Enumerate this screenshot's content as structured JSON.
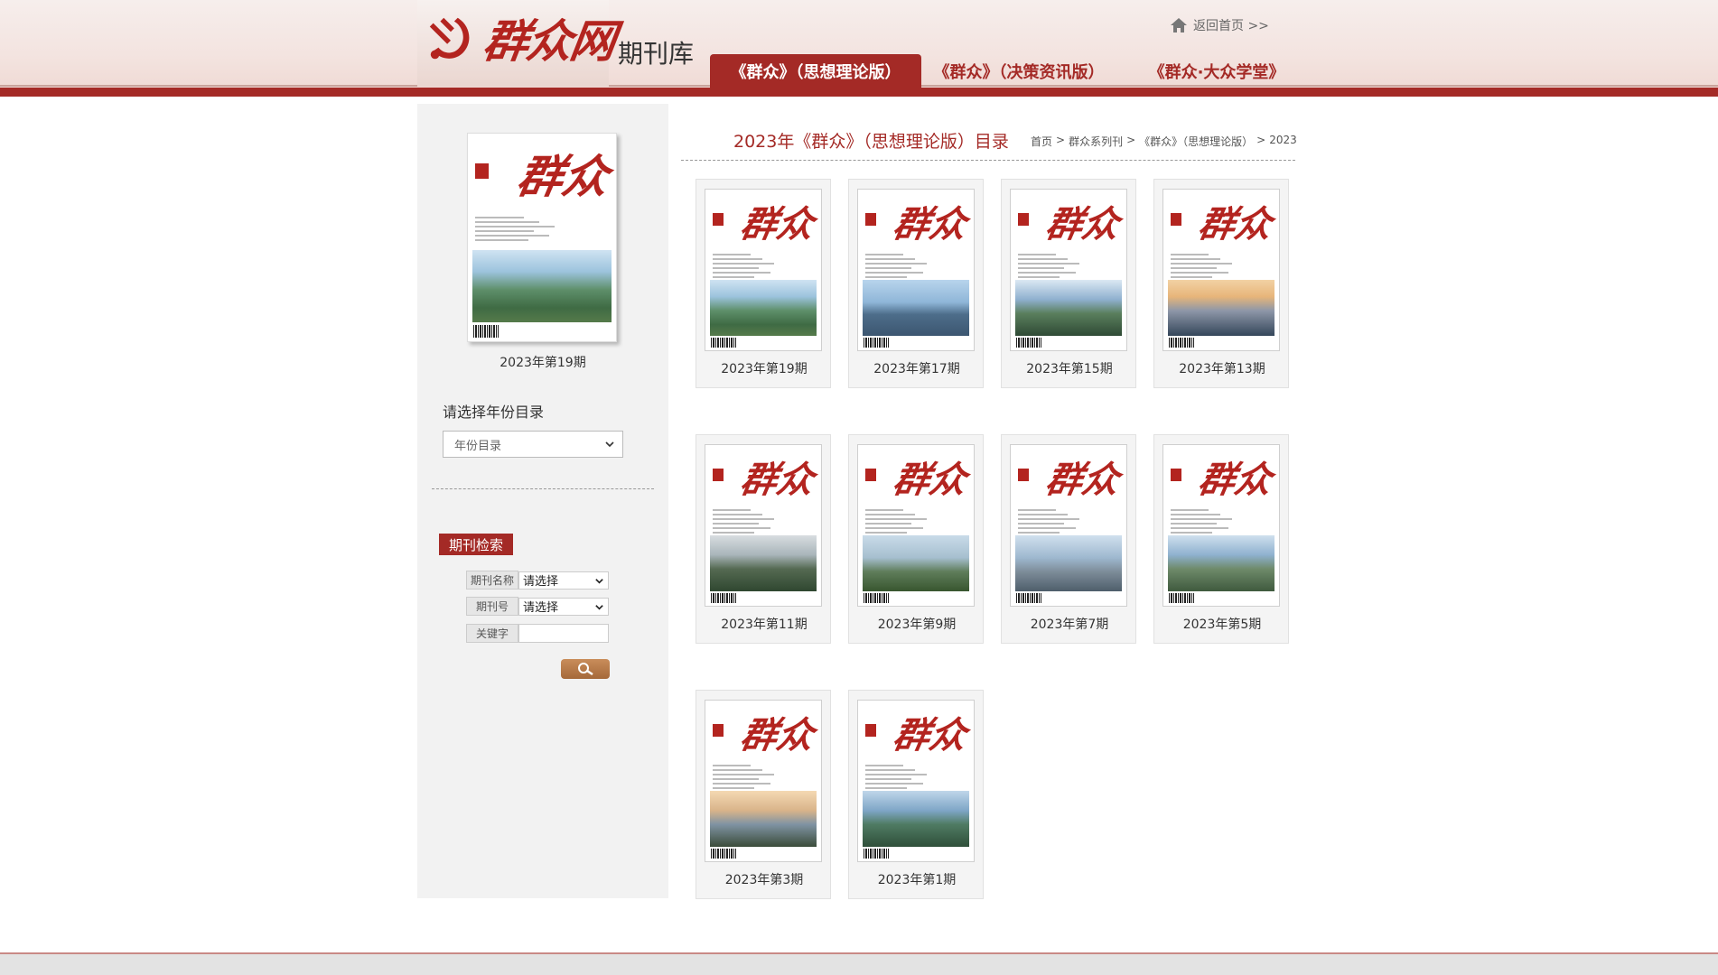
{
  "header": {
    "logo_text": "群众网",
    "site_subtitle": "期刊库",
    "home_link": "返回首页 >>",
    "tabs": [
      {
        "label": "《群众》（思想理论版）",
        "active": true
      },
      {
        "label": "《群众》（决策资讯版）",
        "active": false
      },
      {
        "label": "《群众·大众学堂》",
        "active": false
      }
    ]
  },
  "sidebar": {
    "featured_caption": "2023年第19期",
    "year_title": "请选择年份目录",
    "year_select_value": "年份目录",
    "search_title": "期刊检索",
    "fields": {
      "name_label": "期刊名称",
      "name_value": "请选择",
      "issue_label": "期刊号",
      "issue_value": "请选择",
      "keyword_label": "关键字"
    }
  },
  "main": {
    "title": "2023年《群众》（思想理论版）目录",
    "breadcrumb": [
      "首页",
      "群众系列刊",
      "《群众》（思想理论版）",
      "2023"
    ]
  },
  "issues": [
    {
      "label": "2023年第19期",
      "photo": "lake"
    },
    {
      "label": "2023年第17期",
      "photo": "bridge"
    },
    {
      "label": "2023年第15期",
      "photo": "city"
    },
    {
      "label": "2023年第13期",
      "photo": "sunset"
    },
    {
      "label": "2023年第11期",
      "photo": "green"
    },
    {
      "label": "2023年第9期",
      "photo": "forest"
    },
    {
      "label": "2023年第7期",
      "photo": "harbor"
    },
    {
      "label": "2023年第5期",
      "photo": "town"
    },
    {
      "label": "2023年第3期",
      "photo": "dusk"
    },
    {
      "label": "2023年第1期",
      "photo": "river"
    }
  ],
  "colors": {
    "brand": "#a42a26",
    "panel": "#f2f2f2"
  }
}
